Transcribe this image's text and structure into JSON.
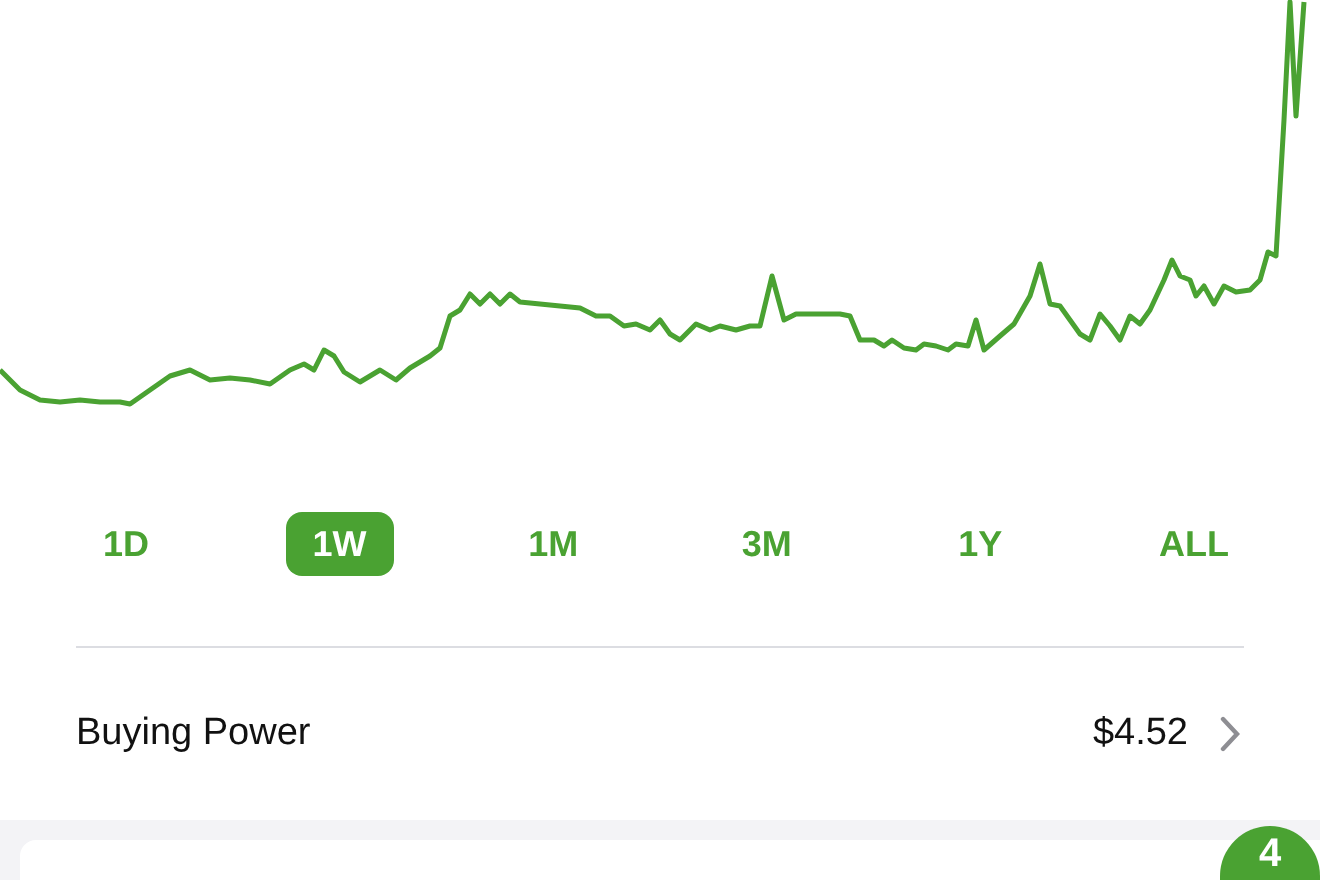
{
  "ranges": [
    {
      "label": "1D",
      "selected": false
    },
    {
      "label": "1W",
      "selected": true
    },
    {
      "label": "1M",
      "selected": false
    },
    {
      "label": "3M",
      "selected": false
    },
    {
      "label": "1Y",
      "selected": false
    },
    {
      "label": "ALL",
      "selected": false
    }
  ],
  "buying_power": {
    "label": "Buying Power",
    "value": "$4.52"
  },
  "badge": {
    "count": "4"
  }
}
